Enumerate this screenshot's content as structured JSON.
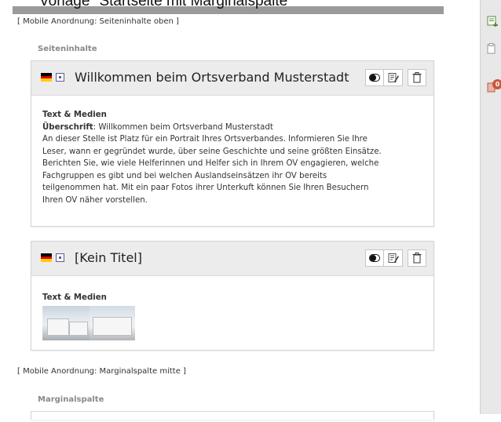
{
  "caption": "Vorlage \"Startseite mit Marginalspalte\"",
  "mobile_notes": {
    "top": "[ Mobile Anordnung: Seiteninhalte oben ]",
    "middle": "[ Mobile Anordnung: Marginalspalte mitte ]"
  },
  "sections": {
    "main": "Seiteninhalte",
    "margin": "Marginalspalte"
  },
  "cards": [
    {
      "title": "Willkommen beim Ortsverband Musterstadt",
      "content_type": "Text & Medien",
      "heading_key": "Überschrift",
      "heading_value": ": Willkommen beim Ortsverband Musterstadt",
      "body_lines": [
        "An dieser Stelle ist Platz für ein Portrait Ihres Ortsverbandes. Informieren Sie Ihre",
        "Leser, wann er gegründet wurde, über seine Geschichte und seine größten Einsätze.",
        "Berichten Sie, wie viele Helferinnen und Helfer sich in Ihrem OV engagieren, welche",
        "Fachgruppen es gibt und bei welchen Auslandseinsätzen ihr OV bereits",
        "teilgenommen hat. Mit ein paar Fotos ihrer Unterkuft können Sie Ihren Besuchern",
        "Ihren OV näher vorstellen."
      ]
    },
    {
      "title": "[Kein Titel]",
      "content_type": "Text & Medien"
    }
  ],
  "sidebar_badge": "0",
  "colors": {
    "card_header": "#ececec",
    "sidebar": "#e8e8e8",
    "badge": "#c9573c",
    "icon_green": "#5c8a3a"
  },
  "icons": [
    "flag-de-icon",
    "page-icon",
    "toggle-visibility-icon",
    "edit-icon",
    "delete-icon",
    "new-content-icon",
    "clipboard-icon",
    "recycler-icon"
  ]
}
